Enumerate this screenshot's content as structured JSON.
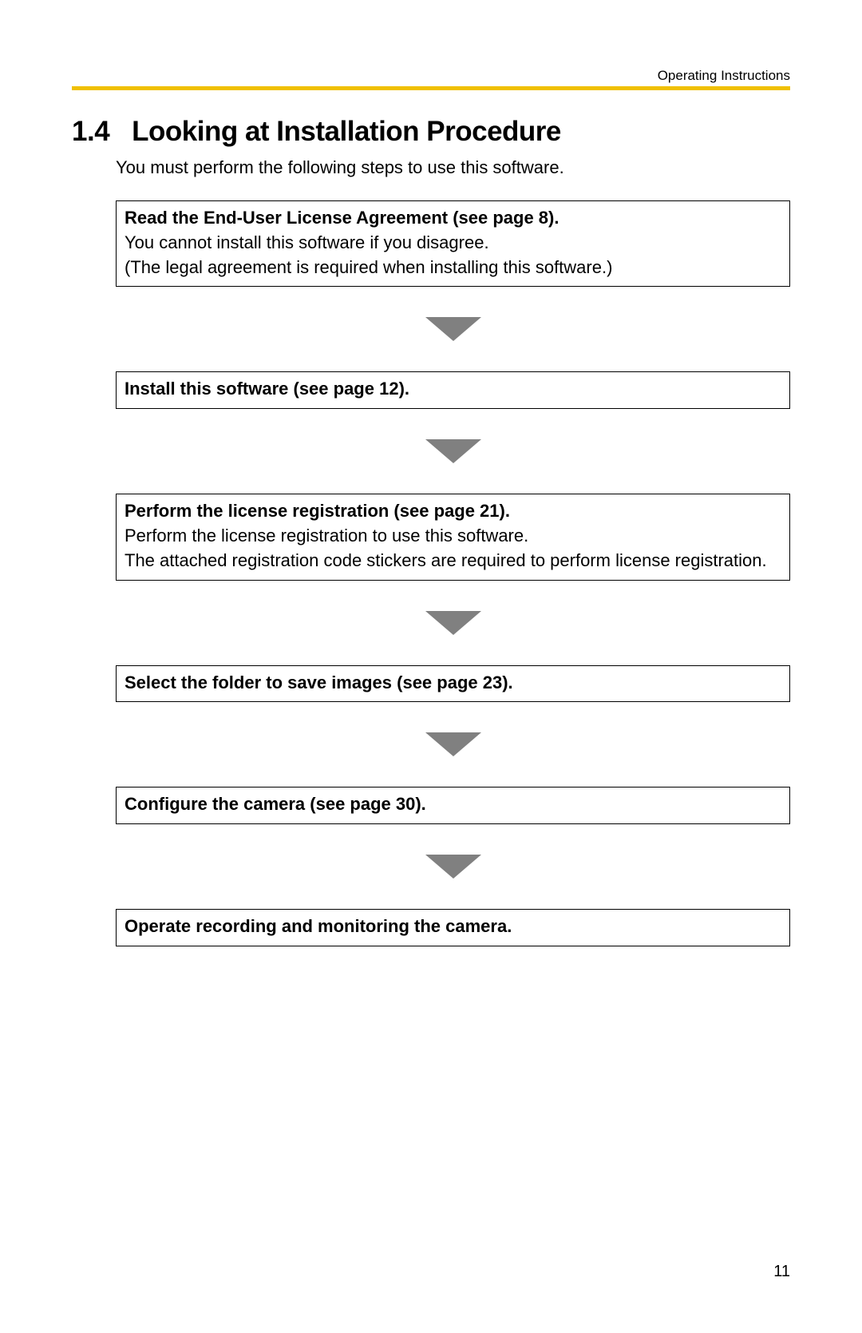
{
  "header": {
    "running_title": "Operating Instructions"
  },
  "section": {
    "number": "1.4",
    "title": "Looking at Installation Procedure",
    "intro": "You must perform the following steps to use this software."
  },
  "steps": [
    {
      "title": "Read the End-User License Agreement (see page 8).",
      "body": "You cannot install this software if you disagree.\n(The legal agreement is required when installing this software.)"
    },
    {
      "title": "Install this software (see page 12).",
      "body": ""
    },
    {
      "title": "Perform the license registration (see page 21).",
      "body": "Perform the license registration to use this software.\nThe attached registration code stickers are required to perform license registration."
    },
    {
      "title": "Select the folder to save images (see page 23).",
      "body": ""
    },
    {
      "title": "Configure the camera (see page 30).",
      "body": ""
    },
    {
      "title": "Operate recording and monitoring the camera.",
      "body": ""
    }
  ],
  "page_number": "11"
}
